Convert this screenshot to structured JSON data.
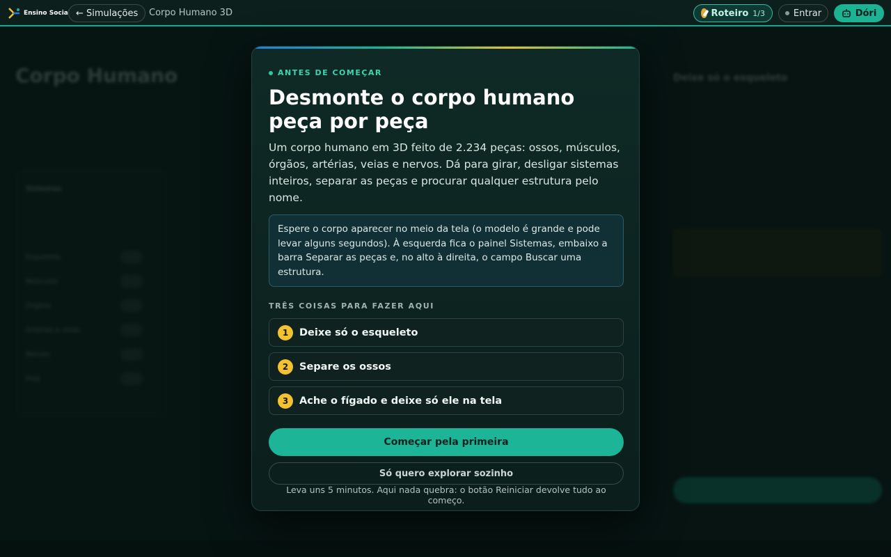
{
  "topbar": {
    "brand": "Ensino Social",
    "back_label": "← Simulações",
    "breadcrumb": "Corpo Humano 3D",
    "roteiro_label": "Roteiro",
    "roteiro_count": "1/3",
    "entrar_label": "Entrar",
    "dori_label": "Dóri",
    "accent": "#1bb394"
  },
  "background": {
    "page_title": "Corpo Humano",
    "panel_title": "Sistemas",
    "systems": [
      "Esqueleto",
      "Músculos",
      "Órgãos",
      "Artérias e veias",
      "Nervos",
      "Pele"
    ],
    "right_title": "Deixe só o esqueleto"
  },
  "modal": {
    "eyebrow": "ANTES DE COMEÇAR",
    "heading": "Desmonte o corpo humano peça por peça",
    "intro": "Um corpo humano em 3D feito de 2.234 peças: ossos, músculos, órgãos, artérias, veias e nervos. Dá para girar, desligar sistemas inteiros, separar as peças e procurar qualquer estrutura pelo nome.",
    "note": "Espere o corpo aparecer no meio da tela (o modelo é grande e pode levar alguns segundos). À esquerda fica o painel Sistemas, embaixo a barra Separar as peças e, no alto à direita, o campo Buscar uma estrutura.",
    "steps_heading": "TRÊS COISAS PARA FAZER AQUI",
    "steps": [
      {
        "num": "1",
        "label": "Deixe só o esqueleto"
      },
      {
        "num": "2",
        "label": "Separe os ossos"
      },
      {
        "num": "3",
        "label": "Ache o fígado e deixe só ele na tela"
      }
    ],
    "primary_label": "Começar pela primeira",
    "secondary_label": "Só quero explorar sozinho",
    "hint": "Leva uns 5 minutos. Aqui nada quebra: o botão Reiniciar devolve tudo ao começo."
  }
}
